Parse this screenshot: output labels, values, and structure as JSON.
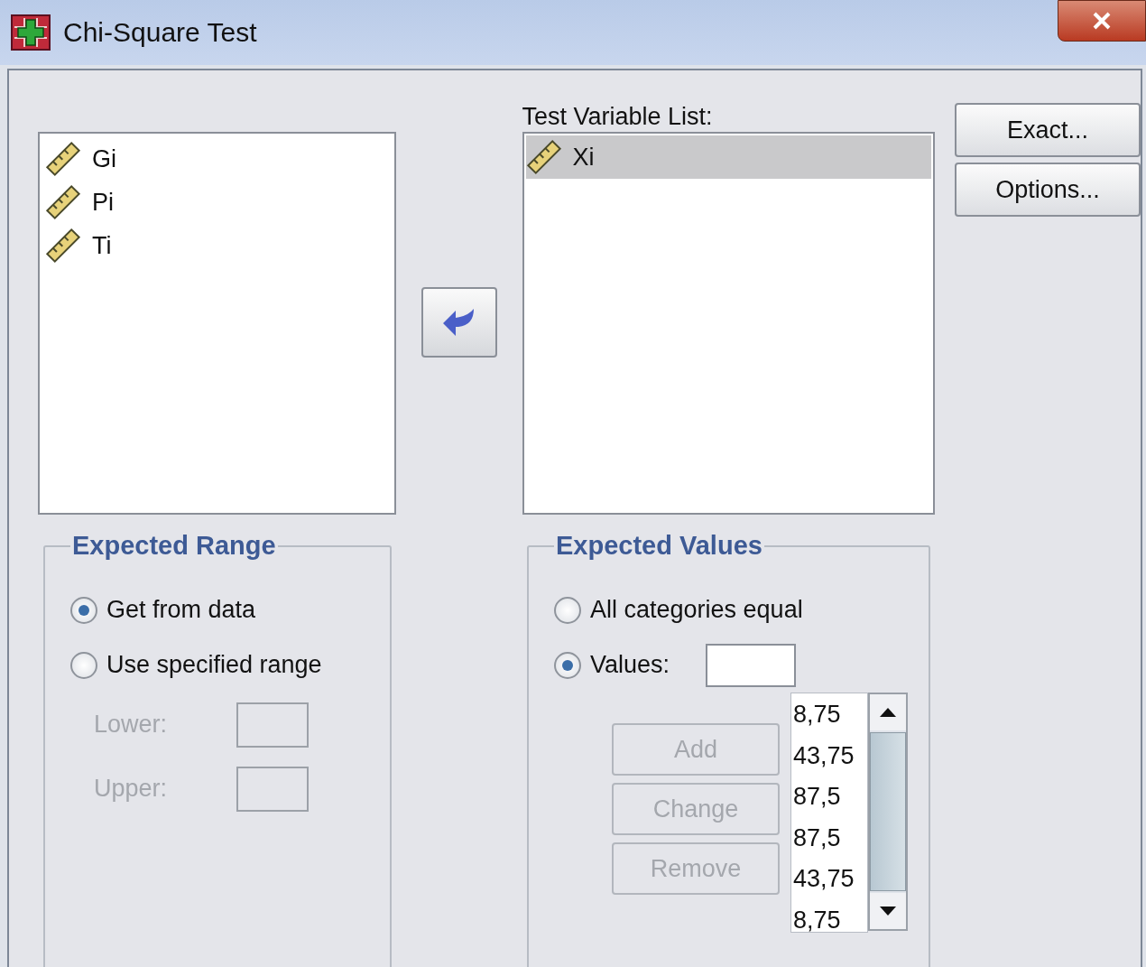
{
  "window": {
    "title": "Chi-Square Test"
  },
  "source_variables": [
    {
      "name": "Gi"
    },
    {
      "name": "Pi"
    },
    {
      "name": "Ti"
    }
  ],
  "test_variable_list": {
    "label": "Test Variable List:",
    "items": [
      {
        "name": "Xi",
        "selected": true
      }
    ]
  },
  "side_buttons": [
    "Exact...",
    "Options..."
  ],
  "expected_range": {
    "title": "Expected Range",
    "options": [
      {
        "label": "Get from data",
        "selected": true
      },
      {
        "label": "Use specified range",
        "selected": false
      }
    ],
    "fields": [
      {
        "label": "Lower:",
        "disabled": true
      },
      {
        "label": "Upper:",
        "disabled": true
      }
    ]
  },
  "expected_values": {
    "title": "Expected Values",
    "options": [
      {
        "label": "All categories equal",
        "selected": false
      },
      {
        "label": "Values:",
        "selected": true
      }
    ],
    "buttons": [
      {
        "label": "Add",
        "disabled": true
      },
      {
        "label": "Change",
        "disabled": true
      },
      {
        "label": "Remove",
        "disabled": true
      }
    ],
    "values": [
      "8,75",
      "43,75",
      "87,5",
      "87,5",
      "43,75",
      "8,75"
    ]
  }
}
